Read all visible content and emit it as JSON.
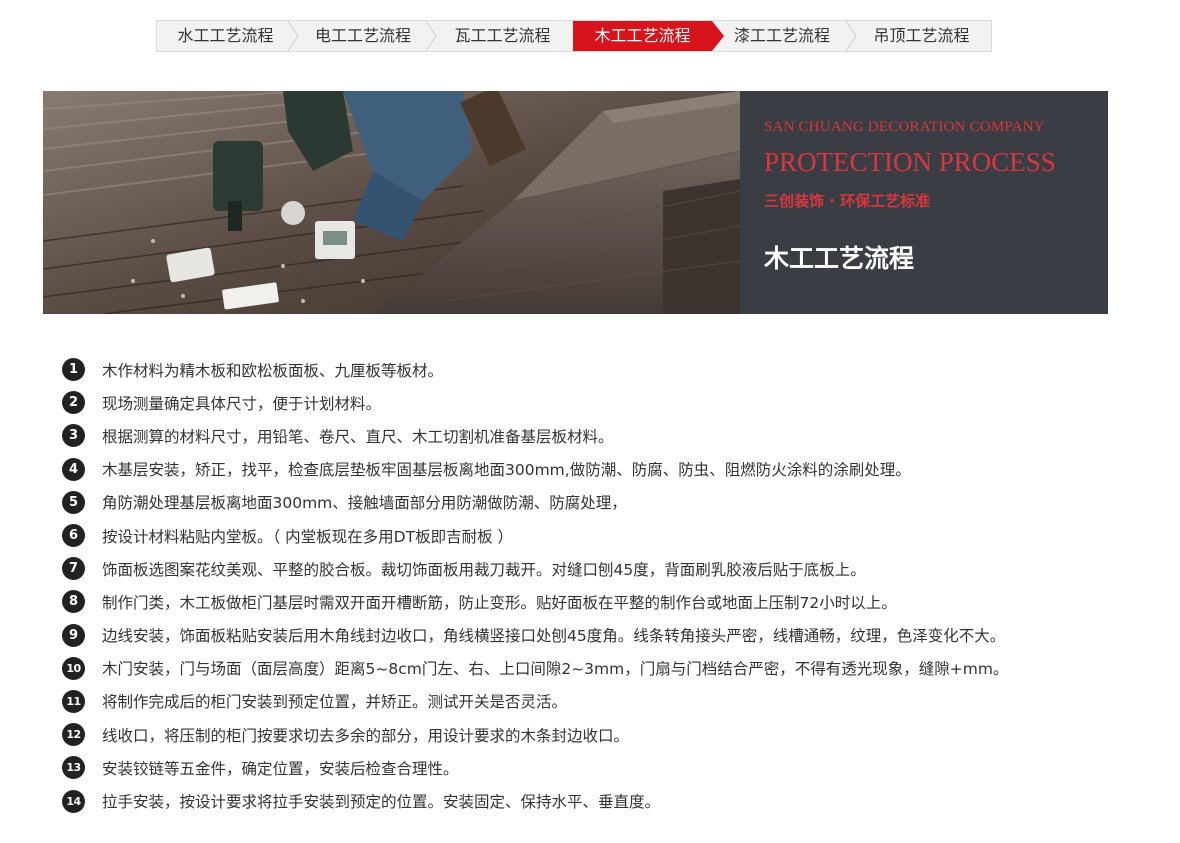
{
  "tabs": [
    {
      "label": "水工工艺流程",
      "active": false
    },
    {
      "label": "电工工艺流程",
      "active": false
    },
    {
      "label": "瓦工工艺流程",
      "active": false
    },
    {
      "label": "木工工艺流程",
      "active": true
    },
    {
      "label": "漆工工艺流程",
      "active": false
    },
    {
      "label": "吊顶工艺流程",
      "active": false
    }
  ],
  "banner": {
    "company": "SAN CHUANG DECORATION COMPANY",
    "process": "PROTECTION PROCESS",
    "slogan": "三创装饰 · 环保工艺标准",
    "title": "木工工艺流程"
  },
  "colors": {
    "accent": "#d7131c",
    "panel": "#3a3d44",
    "badge": "#222222"
  },
  "steps": [
    {
      "num": "1",
      "text": "木作材料为精木板和欧松板面板、九厘板等板材。"
    },
    {
      "num": "2",
      "text": "现场测量确定具体尺寸，便于计划材料。"
    },
    {
      "num": "3",
      "text": "根据测算的材料尺寸，用铅笔、卷尺、直尺、木工切割机准备基层板材料。"
    },
    {
      "num": "4",
      "text": "木基层安装，矫正，找平，检查底层垫板牢固基层板离地面300mm,做防潮、防腐、防虫、阻燃防火涂料的涂刷处理。"
    },
    {
      "num": "5",
      "text": "角防潮处理基层板离地面300mm、接触墙面部分用防潮做防潮、防腐处理，"
    },
    {
      "num": "6",
      "text": "按设计材料粘贴内堂板。（ 内堂板现在多用DT板即吉耐板 ）"
    },
    {
      "num": "7",
      "text": "饰面板选图案花纹美观、平整的胶合板。裁切饰面板用裁刀裁开。对缝口刨45度，背面刷乳胶液后贴于底板上。"
    },
    {
      "num": "8",
      "text": "制作门类，木工板做柜门基层时需双开面开槽断筋，防止变形。贴好面板在平整的制作台或地面上压制72小时以上。"
    },
    {
      "num": "9",
      "text": "边线安装，饰面板粘贴安装后用木角线封边收口，角线横竖接口处刨45度角。线条转角接头严密，线槽通畅，纹理，色泽变化不大。"
    },
    {
      "num": "10",
      "text": "木门安装，门与场面（面层高度）距离5~8cm门左、右、上口间隙2~3mm，门扇与门档结合严密，不得有透光现象，缝隙+mm。"
    },
    {
      "num": "11",
      "text": "将制作完成后的柜门安装到预定位置，并矫正。测试开关是否灵活。"
    },
    {
      "num": "12",
      "text": "线收口，将压制的柜门按要求切去多余的部分，用设计要求的木条封边收口。"
    },
    {
      "num": "13",
      "text": "安装铰链等五金件，确定位置，安装后检查合理性。"
    },
    {
      "num": "14",
      "text": "拉手安装，按设计要求将拉手安装到预定的位置。安装固定、保持水平、垂直度。"
    }
  ]
}
